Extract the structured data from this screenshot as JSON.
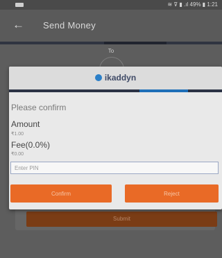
{
  "status_bar": {
    "right_text": "≋ ⊽ ▮ .ıl 49% ▮ 1:21"
  },
  "app_bar": {
    "back_icon": "←",
    "title": "Send Money"
  },
  "background": {
    "to_label": "To",
    "submit_label": "Submit"
  },
  "dialog": {
    "brand": "ikaddyn",
    "title": "Please confirm",
    "amount_label": "Amount",
    "amount_value": "₹1.00",
    "fee_label": "Fee(0.0%)",
    "fee_value": "₹0.00",
    "pin_placeholder": "Enter PIN",
    "confirm_label": "Confirm",
    "reject_label": "Reject"
  },
  "colors": {
    "accent": "#e96a26",
    "brand_blue": "#2b7fc8",
    "header_navy": "#2c3345"
  }
}
